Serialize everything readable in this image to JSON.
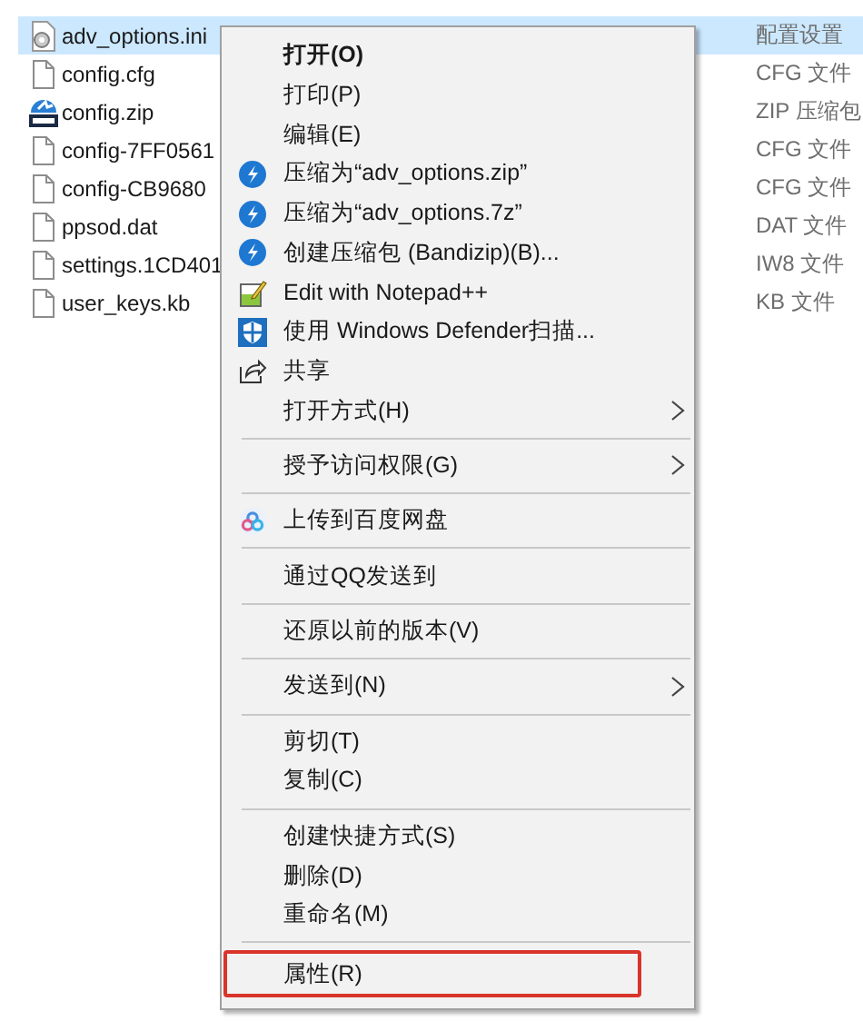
{
  "files": [
    {
      "name": "adv_options.ini",
      "type": "配置设置",
      "kind": "settings",
      "selected": true
    },
    {
      "name": "config.cfg",
      "type": "CFG 文件",
      "kind": "document",
      "selected": false
    },
    {
      "name": "config.zip",
      "type": "ZIP 压缩包",
      "kind": "archive",
      "selected": false
    },
    {
      "name": "config-7FF0561",
      "type": "CFG 文件",
      "kind": "document",
      "selected": false
    },
    {
      "name": "config-CB9680",
      "type": "CFG 文件",
      "kind": "document",
      "selected": false
    },
    {
      "name": "ppsod.dat",
      "type": "DAT 文件",
      "kind": "document",
      "selected": false
    },
    {
      "name": "settings.1CD401",
      "type": "IW8 文件",
      "kind": "document",
      "selected": false
    },
    {
      "name": "user_keys.kb",
      "type": "KB 文件",
      "kind": "document",
      "selected": false
    }
  ],
  "context_menu": [
    {
      "kind": "plain",
      "label": "打开(O)",
      "default": true,
      "submenu": false,
      "outlined": false
    },
    {
      "kind": "plain",
      "label": "打印(P)",
      "default": false,
      "submenu": false,
      "outlined": false
    },
    {
      "kind": "plain",
      "label": "编辑(E)",
      "default": false,
      "submenu": false,
      "outlined": false
    },
    {
      "kind": "bandizip",
      "label": "压缩为“adv_options.zip”",
      "default": false,
      "submenu": false,
      "outlined": false
    },
    {
      "kind": "bandizip",
      "label": "压缩为“adv_options.7z”",
      "default": false,
      "submenu": false,
      "outlined": false
    },
    {
      "kind": "bandizip",
      "label": "创建压缩包 (Bandizip)(B)...",
      "default": false,
      "submenu": false,
      "outlined": false
    },
    {
      "kind": "notepad",
      "label": "Edit with Notepad++",
      "default": false,
      "submenu": false,
      "outlined": false
    },
    {
      "kind": "shield",
      "label": "使用 Windows Defender扫描...",
      "default": false,
      "submenu": false,
      "outlined": false
    },
    {
      "kind": "share",
      "label": "共享",
      "default": false,
      "submenu": false,
      "outlined": false
    },
    {
      "kind": "plain",
      "label": "打开方式(H)",
      "default": false,
      "submenu": true,
      "outlined": false
    },
    {
      "kind": "separator"
    },
    {
      "kind": "plain",
      "label": "授予访问权限(G)",
      "default": false,
      "submenu": true,
      "outlined": false
    },
    {
      "kind": "separator"
    },
    {
      "kind": "cloud",
      "label": "上传到百度网盘",
      "default": false,
      "submenu": false,
      "outlined": false
    },
    {
      "kind": "separator"
    },
    {
      "kind": "plain",
      "label": "通过QQ发送到",
      "default": false,
      "submenu": false,
      "outlined": false
    },
    {
      "kind": "separator"
    },
    {
      "kind": "plain",
      "label": "还原以前的版本(V)",
      "default": false,
      "submenu": false,
      "outlined": false
    },
    {
      "kind": "separator"
    },
    {
      "kind": "plain",
      "label": "发送到(N)",
      "default": false,
      "submenu": true,
      "outlined": false
    },
    {
      "kind": "separator"
    },
    {
      "kind": "plain",
      "label": "剪切(T)",
      "default": false,
      "submenu": false,
      "outlined": false
    },
    {
      "kind": "plain",
      "label": "复制(C)",
      "default": false,
      "submenu": false,
      "outlined": false
    },
    {
      "kind": "separator"
    },
    {
      "kind": "plain",
      "label": "创建快捷方式(S)",
      "default": false,
      "submenu": false,
      "outlined": false
    },
    {
      "kind": "plain",
      "label": "删除(D)",
      "default": false,
      "submenu": false,
      "outlined": false
    },
    {
      "kind": "plain",
      "label": "重命名(M)",
      "default": false,
      "submenu": false,
      "outlined": false
    },
    {
      "kind": "separator"
    },
    {
      "kind": "plain",
      "label": "属性(R)",
      "default": false,
      "submenu": false,
      "outlined": true
    }
  ]
}
